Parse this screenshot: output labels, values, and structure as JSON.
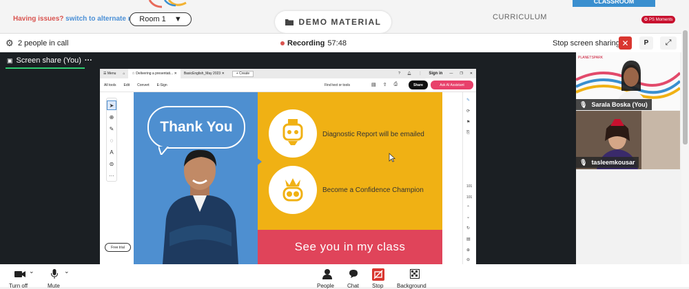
{
  "header": {
    "issues_text": "Having issues?",
    "issues_link": "switch to alternate room",
    "room_value": "Room 1",
    "demo_label": "DEMO MATERIAL",
    "curriculum_label": "CURRICULUM",
    "classroom_label": "CLASSROOM",
    "ps_moments": "PS Moments"
  },
  "call": {
    "people": "2 people in call",
    "recording_label": "Recording",
    "recording_time": "57:48",
    "stop_share": "Stop screen sharing",
    "participant_initial": "P"
  },
  "stage": {
    "tab_label": "Screen share (You)",
    "browser": {
      "tabs": [
        "Menu",
        "Delivering a presentati...",
        "BasicEnglish_May 2023",
        "Create"
      ],
      "signin": "Sign in",
      "menu": [
        "All tools",
        "Edit",
        "Convert",
        "E-Sign"
      ],
      "find": "Find text or tools",
      "share": "Share",
      "ai": "Ask AI Assistant",
      "free_trial": "Free trial",
      "page_num": "101",
      "page_total": "101"
    },
    "slide": {
      "thank_you": "Thank You",
      "item1": "Diagnostic Report will be emailed",
      "item2": "Become a Confidence Champion",
      "bottom": "See you in my class"
    }
  },
  "videos": [
    {
      "name": "Sarala Boska (You)"
    },
    {
      "name": "tasleemkousar"
    }
  ],
  "bottom": {
    "camera_label": "Turn off",
    "mic_label": "Mute",
    "people_label": "People",
    "chat_label": "Chat",
    "stop_label": "Stop",
    "background_label": "Background"
  },
  "colors": {
    "accent_red": "#d9362f",
    "recording": "#d9534f",
    "slide_blue": "#4e8fd0",
    "slide_yellow": "#f0b114",
    "slide_pink": "#e0445a"
  }
}
